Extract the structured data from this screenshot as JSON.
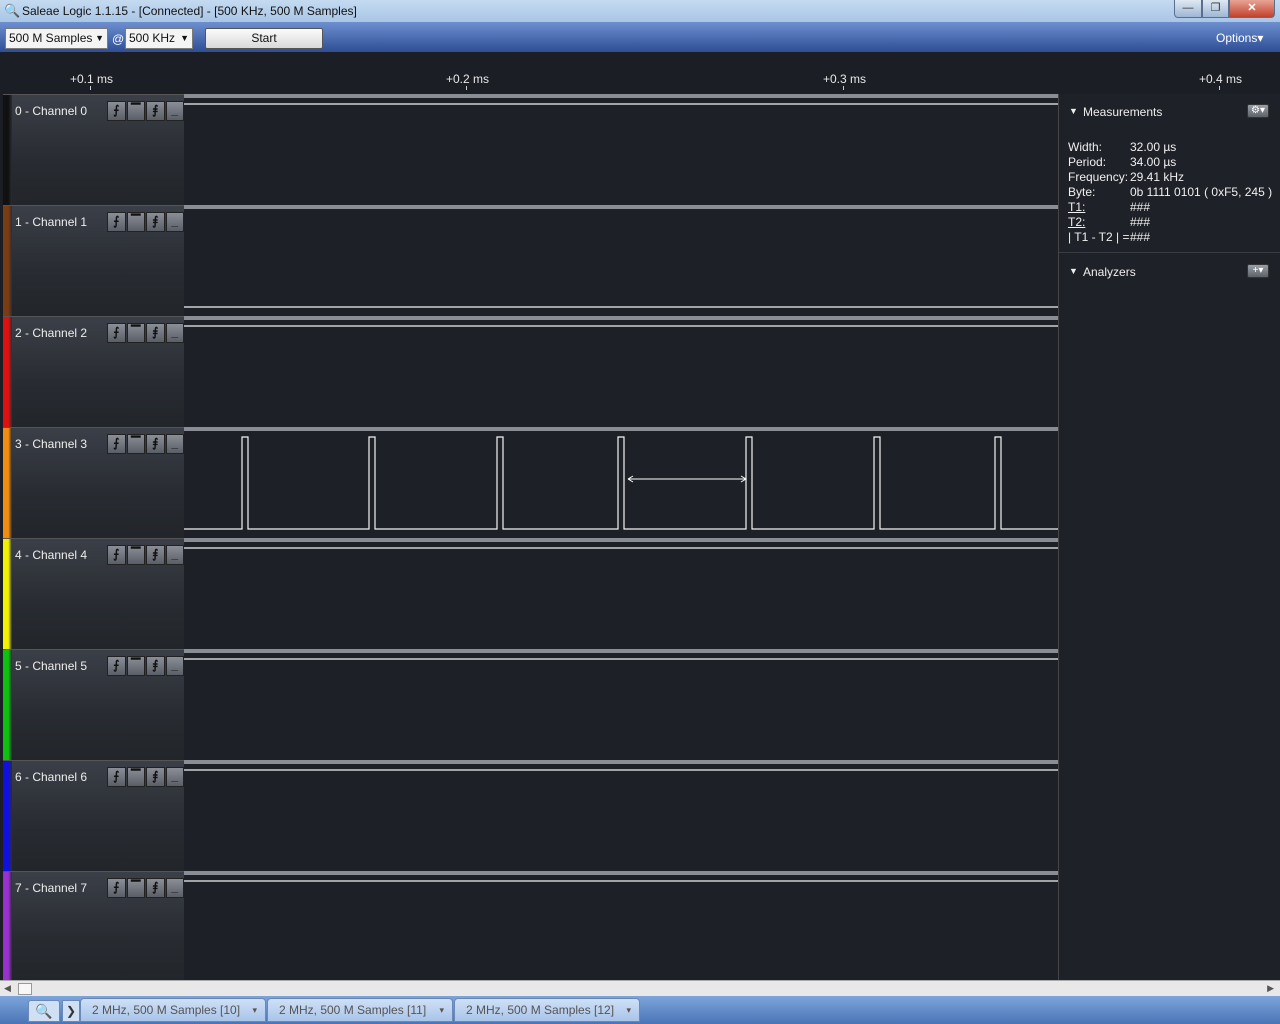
{
  "window": {
    "title": "Saleae Logic 1.1.15 - [Connected] - [500 KHz, 500 M Samples]",
    "min": "—",
    "max": "❐",
    "close": "✕"
  },
  "toolbar": {
    "samples_value": "500 M Samples",
    "at": "@",
    "rate_value": "500 KHz",
    "start_label": "Start",
    "options_label": "Options▾"
  },
  "ruler": {
    "ticks": [
      "+0.1 ms",
      "+0.2 ms",
      "+0.3 ms",
      "+0.4 ms"
    ]
  },
  "channels": [
    {
      "label": "0 - Channel 0",
      "color": "#111111",
      "state": "high"
    },
    {
      "label": "1 - Channel 1",
      "color": "#7a3c12",
      "state": "low"
    },
    {
      "label": "2 - Channel 2",
      "color": "#e01010",
      "state": "high"
    },
    {
      "label": "3 - Channel 3",
      "color": "#f08c10",
      "state": "pulses"
    },
    {
      "label": "4 - Channel 4",
      "color": "#f0f000",
      "state": "high"
    },
    {
      "label": "5 - Channel 5",
      "color": "#10c010",
      "state": "high"
    },
    {
      "label": "6 - Channel 6",
      "color": "#1010e0",
      "state": "high"
    },
    {
      "label": "7 - Channel 7",
      "color": "#9a30d0",
      "state": "high"
    }
  ],
  "trigger_buttons": [
    "⨍",
    "▔",
    "⨎",
    "_"
  ],
  "measurements": {
    "title": "Measurements",
    "settings_icon": "⚙▾",
    "rows": [
      {
        "key": "Width:",
        "value": "32.00 µs"
      },
      {
        "key": "Period:",
        "value": "34.00 µs"
      },
      {
        "key": "Frequency:",
        "value": "29.41 kHz"
      },
      {
        "key": "Byte:",
        "value": "0b  1111  0101  ( 0xF5, 245 )"
      },
      {
        "key": "T1:",
        "value": "###"
      },
      {
        "key": "T2:",
        "value": "###"
      },
      {
        "key": "| T1 - T2 | =",
        "value": "###"
      }
    ]
  },
  "analyzers": {
    "title": "Analyzers",
    "add_icon": "+▾"
  },
  "tabs": {
    "search_icon": "🔍",
    "scroll_icon": "❯",
    "items": [
      "2 MHz, 500 M Samples [10]",
      "2 MHz, 500 M Samples [11]",
      "2 MHz, 500 M Samples [12]"
    ],
    "dropdown_icon": "▾"
  }
}
